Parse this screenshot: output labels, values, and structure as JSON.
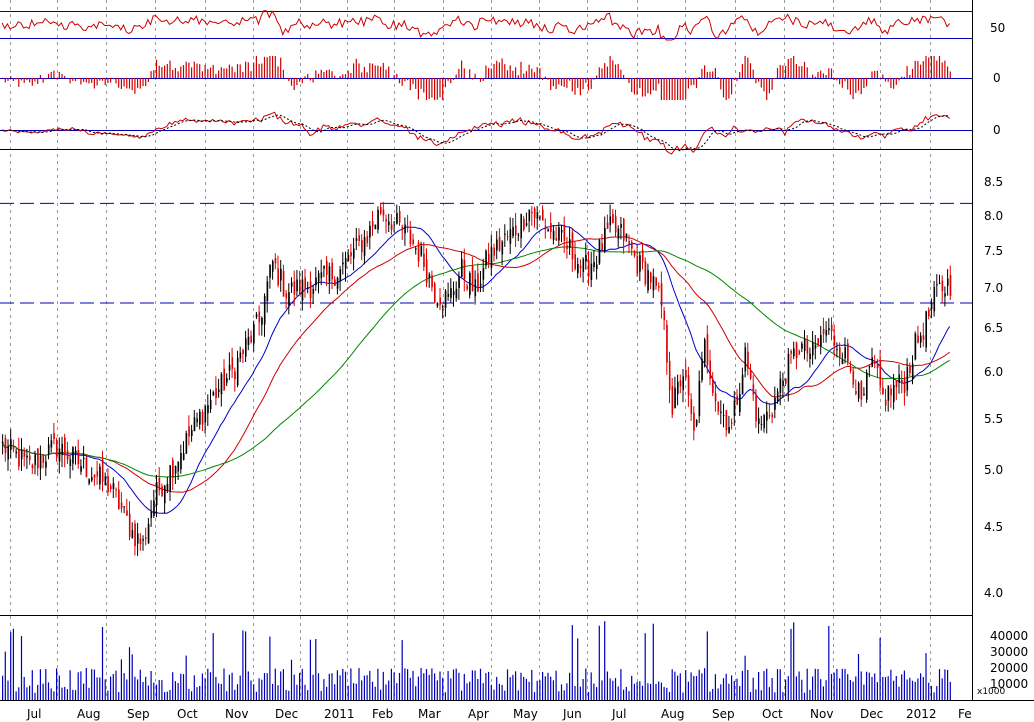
{
  "chart_data": {
    "type": "candlestick",
    "x_axis_labels": [
      "Jul",
      "Aug",
      "Sep",
      "Oct",
      "Nov",
      "Dec",
      "2011",
      "Feb",
      "Mar",
      "Apr",
      "May",
      "Jun",
      "Jul",
      "Aug",
      "Sep",
      "Oct",
      "Nov",
      "Dec",
      "2012",
      "Fe"
    ],
    "price_axis_ticks": [
      "8.5",
      "8.0",
      "7.5",
      "7.0",
      "6.5",
      "6.0",
      "5.5",
      "5.0",
      "4.5",
      "4.0"
    ],
    "price_range": [
      3.9,
      8.6
    ],
    "price_scale": "log",
    "horizontal_reference_lines": [
      8.3,
      6.85
    ],
    "price_anchors": [
      [
        0,
        5.2
      ],
      [
        10,
        5.0
      ],
      [
        20,
        5.2
      ],
      [
        30,
        5.0
      ],
      [
        40,
        4.8
      ],
      [
        48,
        4.4
      ],
      [
        52,
        4.3
      ],
      [
        56,
        4.7
      ],
      [
        65,
        5.1
      ],
      [
        75,
        5.6
      ],
      [
        85,
        6.0
      ],
      [
        95,
        6.6
      ],
      [
        100,
        7.4
      ],
      [
        105,
        7.0
      ],
      [
        115,
        7.1
      ],
      [
        125,
        7.3
      ],
      [
        135,
        7.8
      ],
      [
        140,
        8.2
      ],
      [
        145,
        8.0
      ],
      [
        150,
        7.8
      ],
      [
        155,
        7.5
      ],
      [
        160,
        7.0
      ],
      [
        165,
        6.9
      ],
      [
        170,
        7.3
      ],
      [
        175,
        7.0
      ],
      [
        180,
        7.5
      ],
      [
        190,
        7.9
      ],
      [
        195,
        8.2
      ],
      [
        200,
        8.0
      ],
      [
        205,
        7.8
      ],
      [
        210,
        7.6
      ],
      [
        215,
        7.3
      ],
      [
        220,
        7.5
      ],
      [
        225,
        7.9
      ],
      [
        230,
        7.8
      ],
      [
        235,
        7.4
      ],
      [
        240,
        7.2
      ],
      [
        244,
        6.8
      ],
      [
        248,
        5.6
      ],
      [
        252,
        6.0
      ],
      [
        256,
        5.3
      ],
      [
        260,
        6.3
      ],
      [
        265,
        5.6
      ],
      [
        270,
        5.4
      ],
      [
        275,
        6.2
      ],
      [
        280,
        5.4
      ],
      [
        285,
        5.6
      ],
      [
        290,
        6.0
      ],
      [
        295,
        6.3
      ],
      [
        300,
        6.2
      ],
      [
        305,
        6.5
      ],
      [
        310,
        6.3
      ],
      [
        315,
        6.0
      ],
      [
        318,
        5.6
      ],
      [
        322,
        6.1
      ],
      [
        326,
        5.7
      ],
      [
        330,
        5.8
      ],
      [
        334,
        5.9
      ],
      [
        338,
        6.3
      ],
      [
        342,
        6.6
      ],
      [
        346,
        7.0
      ],
      [
        350,
        7.1
      ]
    ],
    "moving_averages": [
      {
        "period": 10,
        "color": "#0000cc"
      },
      {
        "period": 20,
        "color": "#cc0000"
      },
      {
        "period": 40,
        "color": "#008800"
      }
    ],
    "up_color": "#000000",
    "down_color": "#dd0000",
    "indicator_panels": [
      {
        "type": "line",
        "axis_ticks": [
          "50"
        ],
        "range": [
          40,
          85
        ],
        "reference_lines": [
          38,
          52
        ],
        "color": "#cc0000"
      },
      {
        "type": "histogram",
        "axis_ticks": [
          "0"
        ],
        "range": [
          -1,
          1
        ],
        "reference_lines": [
          0
        ],
        "color": "#cc0000"
      },
      {
        "type": "line",
        "axis_ticks": [
          "0"
        ],
        "range": [
          -1,
          1
        ],
        "reference_lines": [
          0
        ],
        "color": "#cc0000",
        "signal_style": "dashed"
      }
    ],
    "volume_panel": {
      "axis_ticks": [
        "40000",
        "30000",
        "20000",
        "10000"
      ],
      "range": [
        0,
        45000
      ],
      "scale_note": "x1000",
      "color": "#0000bb",
      "typical_volume": 10000,
      "max_volume": 45000
    },
    "reference_line_color": "#0000bb"
  }
}
